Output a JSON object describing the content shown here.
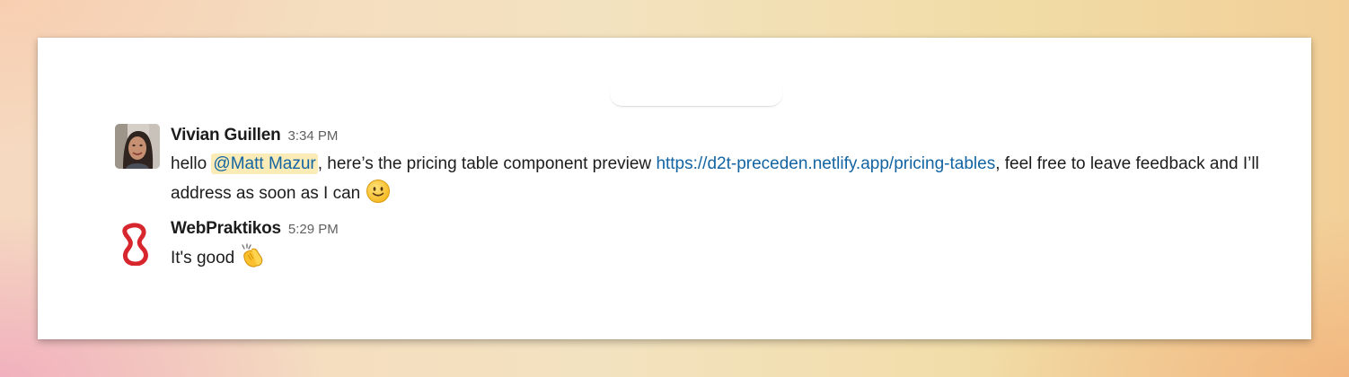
{
  "messages": [
    {
      "author": "Vivian Guillen",
      "time": "3:34 PM",
      "text_before": "hello ",
      "mention": "@Matt Mazur",
      "text_middle": ", here’s the pricing table component preview ",
      "link": "https://d2t-preceden.netlify.app/pricing-tables",
      "text_after": ", feel free to leave feedback and I’ll address as soon as I can ",
      "emoji": "slightly-smiling-face"
    },
    {
      "author": "WebPraktikos",
      "time": "5:29 PM",
      "text": "It's good ",
      "emoji": "clapping-hands"
    }
  ],
  "colors": {
    "mention_bg": "#fbebb6",
    "link": "#1264a3",
    "logo_red": "#d7262d",
    "timestamp": "#616061"
  }
}
